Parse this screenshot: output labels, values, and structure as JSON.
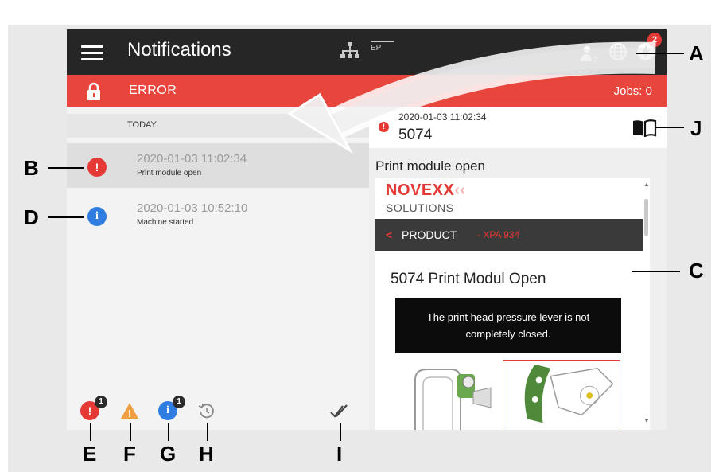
{
  "header": {
    "title": "Notifications",
    "network_icon": "network-icon",
    "ep_label": "EP",
    "user_help_icon": "user-help-icon",
    "globe_icon": "globe-icon",
    "power_icon": "power-icon",
    "notification_count": "2"
  },
  "status_bar": {
    "label": "ERROR",
    "jobs": "Jobs: 0",
    "color": "#e8453c"
  },
  "list": {
    "section": "TODAY",
    "items": [
      {
        "type": "error",
        "time": "2020-01-03 11:02:34",
        "text": "Print module open",
        "icon": "!",
        "color": "#e53935",
        "selected": true
      },
      {
        "type": "info",
        "time": "2020-01-03 10:52:10",
        "text": "Machine started",
        "icon": "i",
        "color": "#2f7de1",
        "selected": false
      }
    ]
  },
  "filters": {
    "error_icon": "!",
    "error_count": "1",
    "warning_icon": "!",
    "info_icon": "i",
    "info_count": "1",
    "history_icon": "history-icon",
    "mark_read_icon": "double-check-icon"
  },
  "detail": {
    "time": "2020-01-03 11:02:34",
    "code": "5074",
    "book_icon": "manual-book-icon",
    "title": "Print module open",
    "brand": "NOVEXX",
    "brand_chevrons": "‹‹",
    "brand_sub": "SOLUTIONS",
    "product_label": "PRODUCT",
    "product_model": "- XPA 934",
    "doc_heading": "5074 Print Modul Open",
    "doc_message": "The print head pressure lever is not completely closed."
  },
  "callouts": {
    "A": "A",
    "B": "B",
    "C": "C",
    "D": "D",
    "E": "E",
    "F": "F",
    "G": "G",
    "H": "H",
    "I": "I",
    "J": "J"
  }
}
